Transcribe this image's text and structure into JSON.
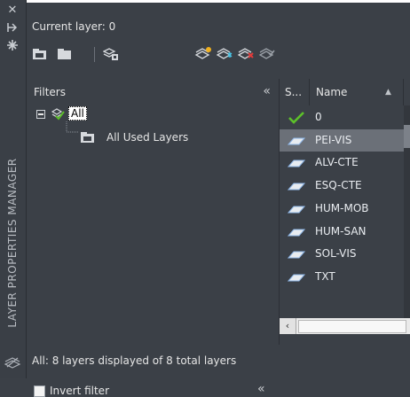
{
  "palette": {
    "title": "LAYER PROPERTIES MANAGER"
  },
  "header": {
    "current_layer": "Current layer: 0"
  },
  "filters": {
    "heading": "Filters",
    "tree": [
      {
        "label": "All"
      },
      {
        "label": "All Used Layers"
      }
    ],
    "invert_label": "Invert filter"
  },
  "layers": {
    "columns": [
      "S...",
      "Name"
    ],
    "rows": [
      {
        "status": "current",
        "name": "0"
      },
      {
        "status": "layer",
        "name": "PEI-VIS",
        "selected": true
      },
      {
        "status": "layer",
        "name": "ALV-CTE"
      },
      {
        "status": "layer",
        "name": "ESQ-CTE"
      },
      {
        "status": "layer",
        "name": "HUM-MOB"
      },
      {
        "status": "layer",
        "name": "HUM-SAN"
      },
      {
        "status": "layer",
        "name": "SOL-VIS"
      },
      {
        "status": "layer",
        "name": "TXT"
      }
    ]
  },
  "status": {
    "text": "All: 8 layers displayed of 8 total layers"
  },
  "colors": {
    "background": "#3b4047",
    "selected_row": "#6b7078",
    "current_check": "#5dc02a"
  }
}
